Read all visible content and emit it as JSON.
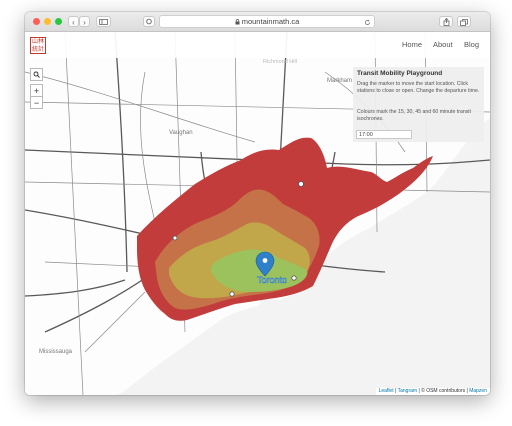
{
  "browser": {
    "url": "mountainmath.ca"
  },
  "site": {
    "logo_text": "山林統計",
    "nav": [
      {
        "label": "Home"
      },
      {
        "label": "About"
      },
      {
        "label": "Blog"
      }
    ]
  },
  "map": {
    "zoom_in": "+",
    "zoom_out": "−",
    "search_icon": "search-icon",
    "places": {
      "richmond_hill": "Richmond Hill",
      "markham": "Markham",
      "vaughan": "Vaughan",
      "mississauga": "Mississauga",
      "toronto": "Toronto"
    },
    "isochrone_colors": {
      "min_15": "#9cc25d",
      "min_30": "#c1a64a",
      "min_45": "#c57248",
      "min_60": "#c13c3b"
    }
  },
  "panel": {
    "title": "Transit Mobility Playground",
    "para1": "Drag the marker to move the start location. Click stations to close or open. Change the departure time.",
    "para2": "Colours mark the 15, 30, 45 and 60 minute transit isochrones.",
    "time_value": "17:00"
  },
  "attribution": {
    "leaflet": "Leaflet",
    "sep1": " | ",
    "tangram": "Tangram",
    "osm": " | © OSM contributors | ",
    "mapzen": "Mapzen"
  }
}
